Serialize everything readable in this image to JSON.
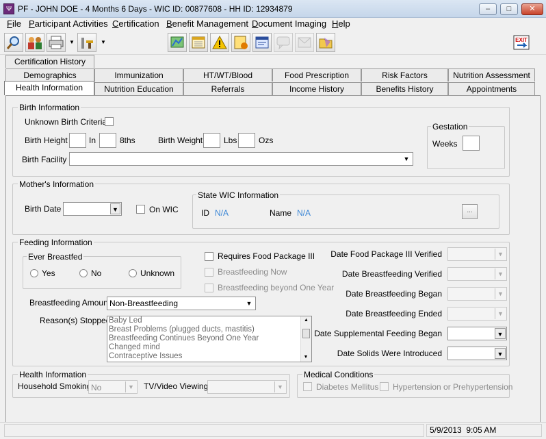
{
  "window": {
    "title": "PF - JOHN DOE - 4 Months 6 Days - WIC ID: 00877608 - HH ID: 12934879",
    "app_icon": "wic-app-icon",
    "btn_min": "–",
    "btn_max": "□",
    "btn_close": "✕"
  },
  "menu": [
    {
      "label": "File",
      "accel": "F",
      "rest": "ile"
    },
    {
      "label": "Participant Activities",
      "accel": "P",
      "rest": "articipant Activities"
    },
    {
      "label": "Certification",
      "accel": "C",
      "rest": "ertification"
    },
    {
      "label": "Benefit Management",
      "accel": "B",
      "rest": "enefit Management"
    },
    {
      "label": "Document Imaging",
      "accel": "D",
      "rest": "ocument Imaging"
    },
    {
      "label": "Help",
      "accel": "H",
      "rest": "elp"
    }
  ],
  "toolbar": {
    "icons": [
      "search-icon",
      "family-icon",
      "printer-icon",
      "tools-icon",
      "map-icon",
      "calendar-icon",
      "alert-icon",
      "note-alert-icon",
      "form-icon",
      "chat-icon",
      "message-icon",
      "folder-icon",
      "exit-icon"
    ],
    "exit_label": "EXIT"
  },
  "tabs": {
    "row3": [
      "Certification History"
    ],
    "row2": [
      "Demographics",
      "Immunization",
      "HT/WT/Blood",
      "Food Prescription",
      "Risk Factors",
      "Nutrition Assessment"
    ],
    "row1": [
      "Health Information",
      "Nutrition Education",
      "Referrals",
      "Income History",
      "Benefits History",
      "Appointments"
    ]
  },
  "birth": {
    "group": "Birth Information",
    "unknown_criteria": "Unknown Birth Criteria",
    "height": "Birth Height",
    "in": "In",
    "eighths": "8ths",
    "weight": "Birth Weight",
    "lbs": "Lbs",
    "ozs": "Ozs",
    "facility": "Birth Facility",
    "gestation_group": "Gestation",
    "weeks": "Weeks"
  },
  "mother": {
    "group": "Mother's Information",
    "birth_date": "Birth Date",
    "on_wic": "On WIC",
    "state_group": "State WIC Information",
    "id_label": "ID",
    "id_value": "N/A",
    "name_label": "Name",
    "name_value": "N/A",
    "lookup_btn": "..."
  },
  "feeding": {
    "group": "Feeding Information",
    "ever_group": "Ever Breastfed",
    "yes": "Yes",
    "no": "No",
    "unknown": "Unknown",
    "requires_pkg": "Requires Food Package III",
    "bf_now": "Breastfeeding Now",
    "bf_beyond": "Breastfeeding beyond One Year",
    "amount_label": "Breastfeeding Amount",
    "amount_value": "Non-Breastfeeding",
    "reasons_label": "Reason(s) Stopped",
    "reasons": [
      "Baby Led",
      "Breast Problems (plugged ducts, mastitis)",
      "Breastfeeding Continues Beyond One Year",
      "Changed mind",
      "Contraceptive Issues"
    ],
    "dates": [
      "Date Food Package III Verified",
      "Date Breastfeeding Verified",
      "Date Breastfeeding Began",
      "Date Breastfeeding Ended",
      "Date Supplemental Feeding Began",
      "Date Solids Were Introduced"
    ]
  },
  "health": {
    "group": "Health Information",
    "smoking_label": "Household Smoking",
    "smoking_value": "No",
    "tv_label": "TV/Video Viewing",
    "tv_value": ""
  },
  "medical": {
    "group": "Medical Conditions",
    "diabetes": "Diabetes Mellitus",
    "hypertension": "Hypertension or Prehypertension"
  },
  "status": {
    "datetime": "5/9/2013  9:05 AM"
  }
}
